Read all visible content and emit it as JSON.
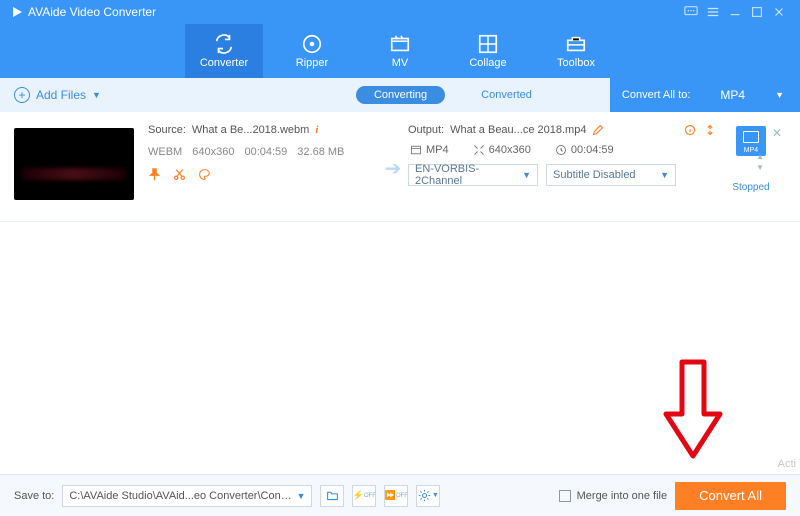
{
  "app": {
    "title": "AVAide Video Converter"
  },
  "nav": {
    "items": [
      {
        "label": "Converter"
      },
      {
        "label": "Ripper"
      },
      {
        "label": "MV"
      },
      {
        "label": "Collage"
      },
      {
        "label": "Toolbox"
      }
    ]
  },
  "subbar": {
    "add_files": "Add Files",
    "tab_converting": "Converting",
    "tab_converted": "Converted",
    "convert_all_to_label": "Convert All to:",
    "convert_all_to_value": "MP4"
  },
  "item": {
    "source_label": "Source:",
    "source_name": "What a Be...2018.webm",
    "source_format": "WEBM",
    "source_res": "640x360",
    "source_dur": "00:04:59",
    "source_size": "32.68 MB",
    "output_label": "Output:",
    "output_name": "What a Beau...ce 2018.mp4",
    "out_format": "MP4",
    "out_res": "640x360",
    "out_dur": "00:04:59",
    "audio_sel": "EN-VORBIS-2Channel",
    "subtitle_sel": "Subtitle Disabled",
    "badge_text": "MP4",
    "status": "Stopped"
  },
  "footer": {
    "save_to_label": "Save to:",
    "path": "C:\\AVAide Studio\\AVAid...eo Converter\\Converted",
    "merge_label": "Merge into one file",
    "convert_all": "Convert All"
  },
  "watermark": "Acti"
}
